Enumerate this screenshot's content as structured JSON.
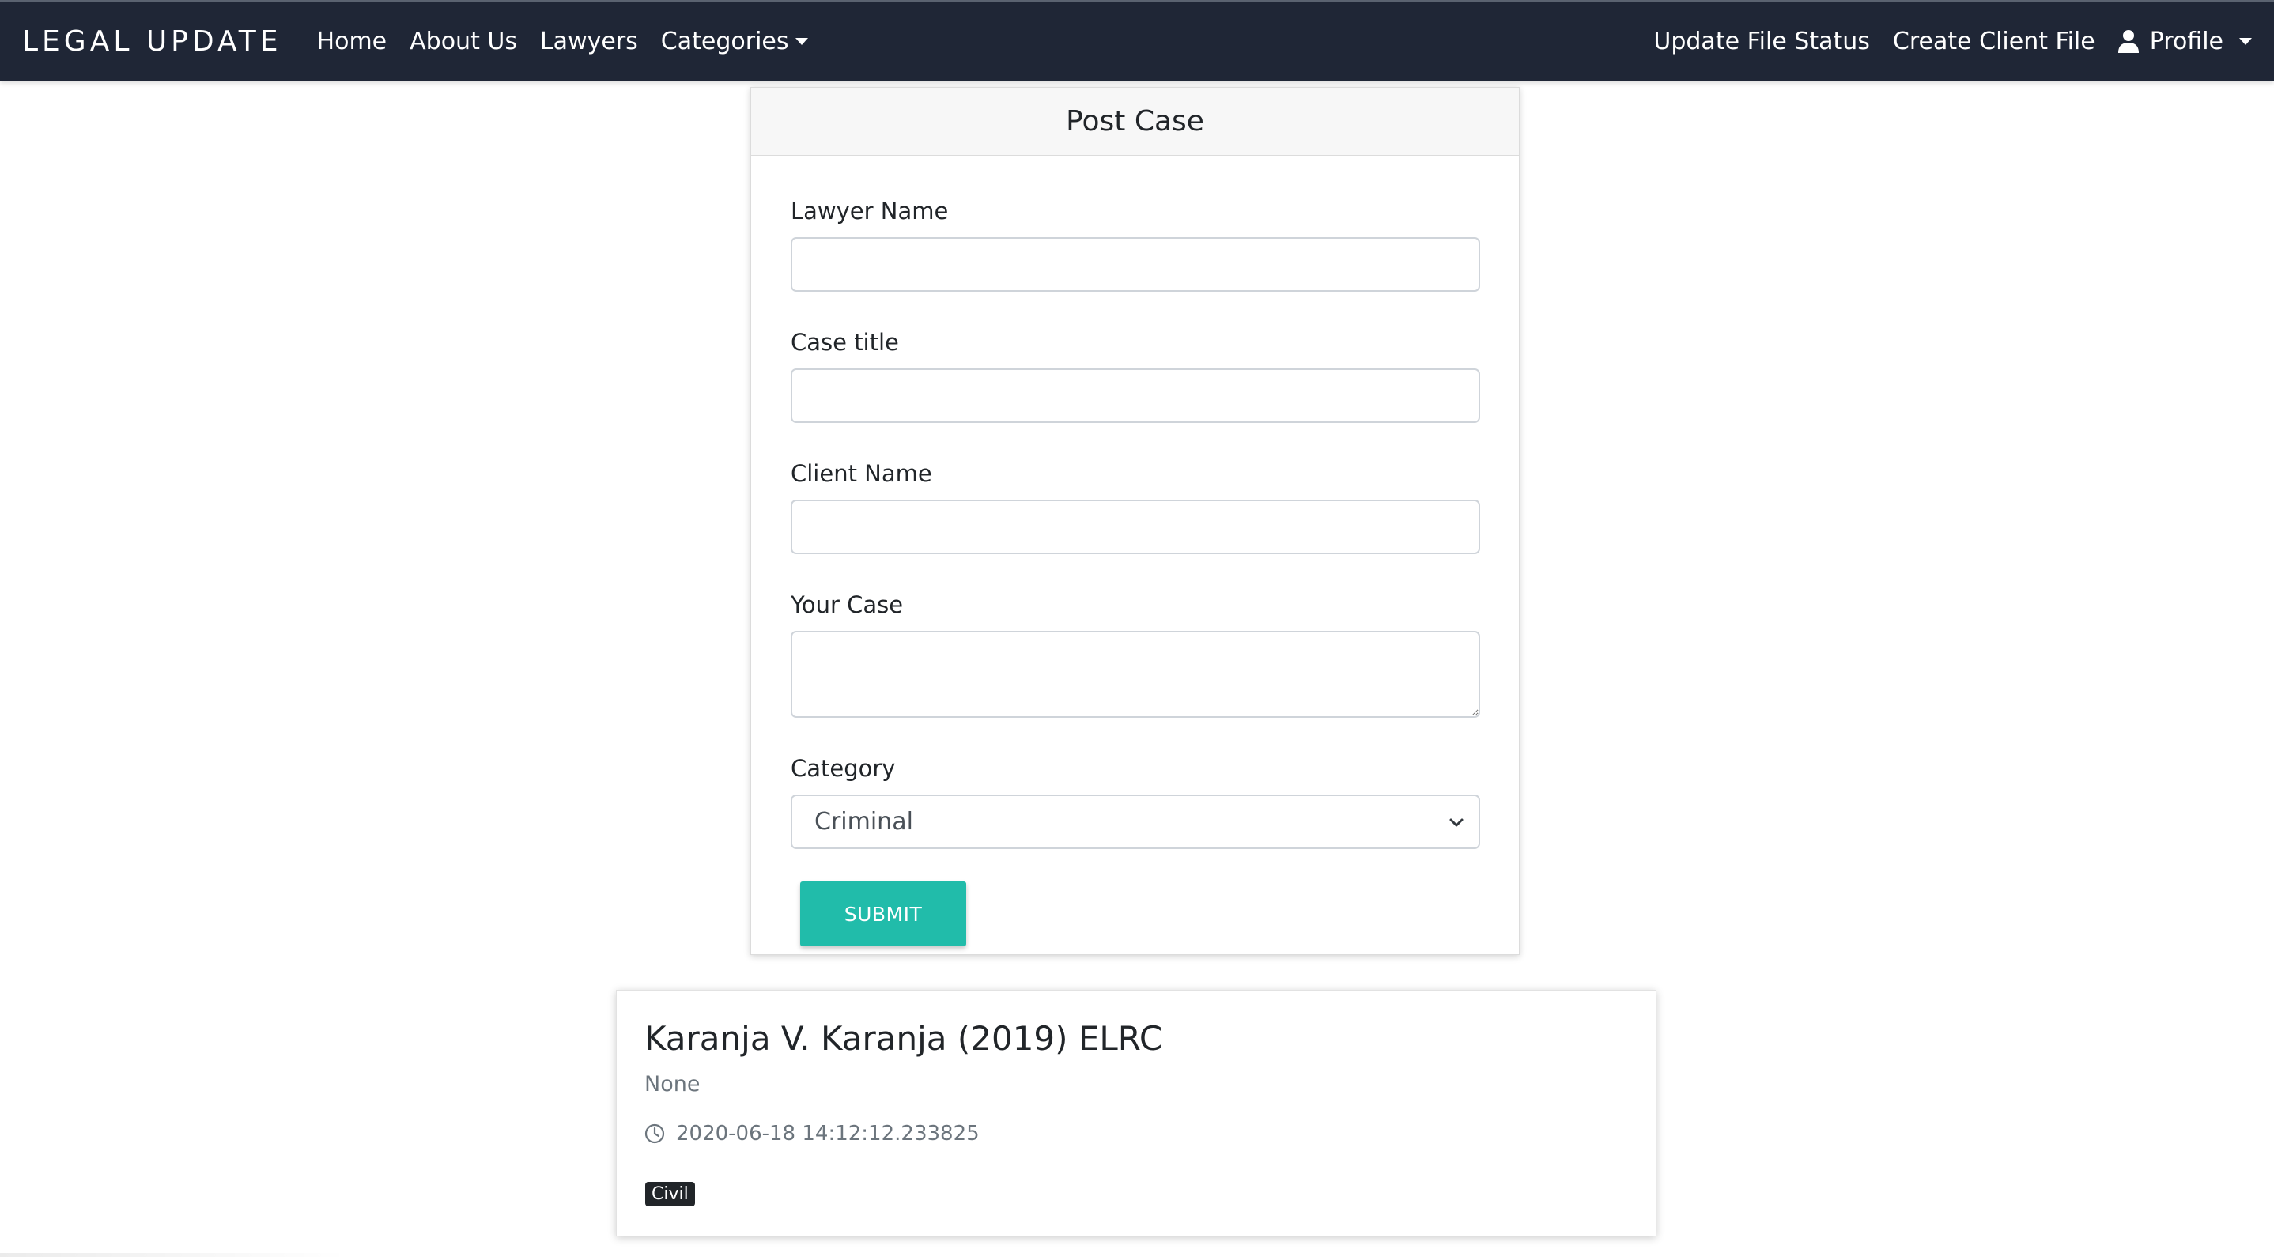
{
  "navbar": {
    "brand": "LEGAL  UPDATE",
    "links": {
      "home": "Home",
      "about": "About Us",
      "lawyers": "Lawyers",
      "categories": "Categories"
    },
    "right": {
      "update_file_status": "Update File Status",
      "create_client_file": "Create Client File",
      "profile": "Profile"
    },
    "background_color": "#1f2636"
  },
  "form": {
    "title": "Post Case",
    "fields": {
      "lawyer_name_label": "Lawyer Name",
      "lawyer_name_value": "",
      "case_title_label": "Case title",
      "case_title_value": "",
      "client_name_label": "Client Name",
      "client_name_value": "",
      "your_case_label": "Your Case",
      "your_case_value": "",
      "category_label": "Category",
      "category_selected": "Criminal"
    },
    "submit_label": "SUBMIT",
    "submit_color": "#21bcaa"
  },
  "case_post": {
    "title": "Karanja V. Karanja (2019) ELRC",
    "description": "None",
    "timestamp": "2020-06-18 14:12:12.233825",
    "category_badge": "Civil"
  },
  "icons": {
    "user": "user-icon",
    "clock": "clock-icon",
    "select_chevron": "chevron-down-icon"
  }
}
